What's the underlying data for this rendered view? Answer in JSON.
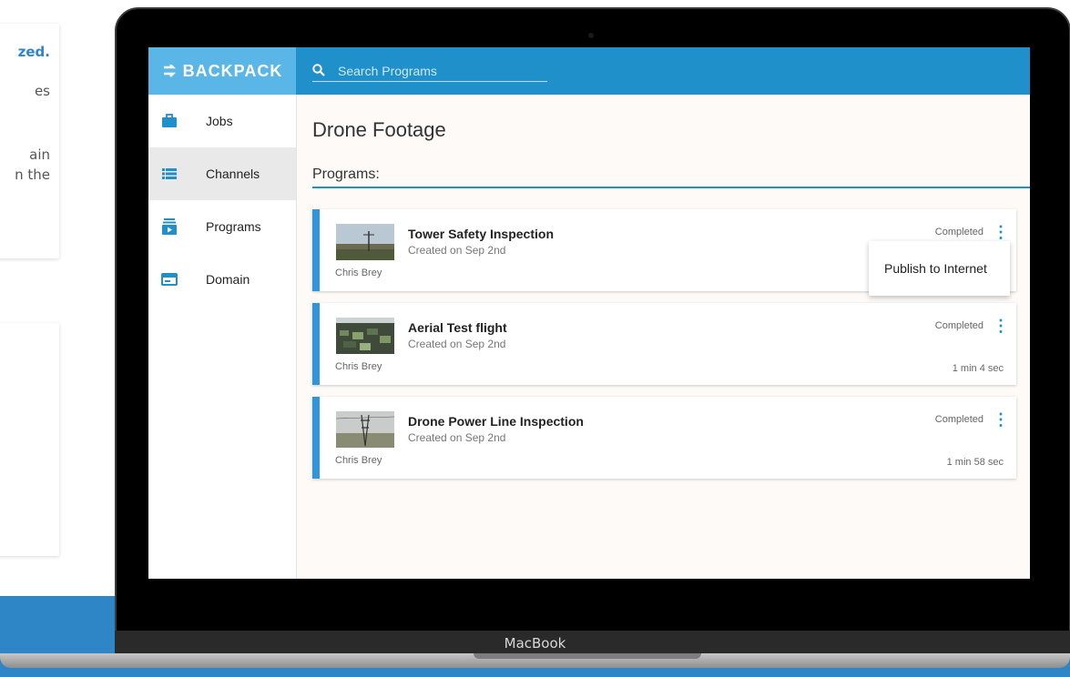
{
  "marketing": {
    "line1": "zed.",
    "line2": "es",
    "line3": "ain",
    "line4": "n the"
  },
  "device": {
    "brand": "MacBook"
  },
  "app": {
    "logo": "BACKPACK",
    "search_placeholder": "Search Programs"
  },
  "sidebar": {
    "items": [
      {
        "label": "Jobs",
        "icon": "briefcase-icon",
        "active": false
      },
      {
        "label": "Channels",
        "icon": "list-icon",
        "active": true
      },
      {
        "label": "Programs",
        "icon": "programs-icon",
        "active": false
      },
      {
        "label": "Domain",
        "icon": "window-icon",
        "active": false
      }
    ]
  },
  "main": {
    "title": "Drone Footage",
    "section": "Programs:",
    "programs": [
      {
        "title": "Tower Safety Inspection",
        "created": "Created on Sep 2nd",
        "owner": "Chris Brey",
        "status": "Completed",
        "duration": ""
      },
      {
        "title": "Aerial Test flight",
        "created": "Created on Sep 2nd",
        "owner": "Chris Brey",
        "status": "Completed",
        "duration": "1 min 4 sec"
      },
      {
        "title": "Drone Power Line Inspection",
        "created": "Created on Sep 2nd",
        "owner": "Chris Brey",
        "status": "Completed",
        "duration": "1 min 58 sec"
      }
    ]
  },
  "context_menu": {
    "item": "Publish to Internet"
  },
  "colors": {
    "accent": "#1f90c9",
    "logo_bg": "#5ab6e6",
    "card_bar": "#2f96de",
    "background_band": "#2f86c7"
  }
}
